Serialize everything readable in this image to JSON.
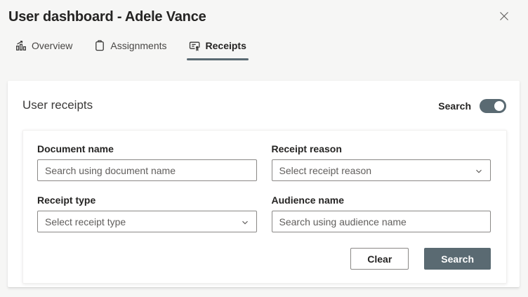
{
  "dialog": {
    "title": "User dashboard - Adele Vance"
  },
  "tabs": [
    {
      "label": "Overview",
      "icon": "bar-chart-icon",
      "active": false
    },
    {
      "label": "Assignments",
      "icon": "clipboard-icon",
      "active": false
    },
    {
      "label": "Receipts",
      "icon": "receipt-icon",
      "active": true
    }
  ],
  "panel": {
    "title": "User receipts",
    "search_toggle": {
      "label": "Search",
      "state": "on"
    }
  },
  "form": {
    "fields": [
      {
        "label": "Document name",
        "control": "text-input",
        "placeholder": "Search using document name"
      },
      {
        "label": "Receipt reason",
        "control": "dropdown",
        "placeholder": "Select receipt reason"
      },
      {
        "label": "Receipt type",
        "control": "dropdown",
        "placeholder": "Select receipt type"
      },
      {
        "label": "Audience name",
        "control": "text-input",
        "placeholder": "Search using audience name"
      }
    ],
    "actions": {
      "clear_label": "Clear",
      "search_label": "Search"
    }
  },
  "colors": {
    "accent": "#5a6a72",
    "page_background": "#f6f6f5",
    "card_background": "#ffffff",
    "label_text": "#252423",
    "placeholder_text": "#605e5c",
    "input_border": "#8a8886"
  }
}
